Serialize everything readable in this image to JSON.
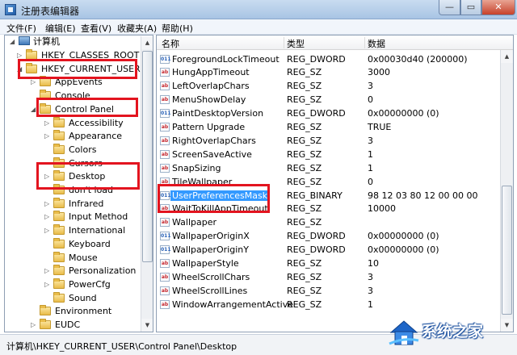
{
  "window": {
    "title": "注册表编辑器",
    "minimize_glyph": "—",
    "maximize_glyph": "▭",
    "close_glyph": "✕"
  },
  "menu": [
    "文件(F)",
    "编辑(E)",
    "查看(V)",
    "收藏夹(A)",
    "帮助(H)"
  ],
  "tree": {
    "root": "计算机",
    "items": [
      {
        "label": "HKEY_CLASSES_ROOT",
        "level": 1,
        "expander": "collapsed"
      },
      {
        "label": "HKEY_CURRENT_USER",
        "level": 1,
        "expander": "expanded"
      },
      {
        "label": "AppEvents",
        "level": 2,
        "expander": "collapsed"
      },
      {
        "label": "Console",
        "level": 2,
        "expander": "none"
      },
      {
        "label": "Control Panel",
        "level": 2,
        "expander": "expanded"
      },
      {
        "label": "Accessibility",
        "level": 3,
        "expander": "collapsed"
      },
      {
        "label": "Appearance",
        "level": 3,
        "expander": "collapsed"
      },
      {
        "label": "Colors",
        "level": 3,
        "expander": "none"
      },
      {
        "label": "Cursors",
        "level": 3,
        "expander": "none"
      },
      {
        "label": "Desktop",
        "level": 3,
        "expander": "collapsed"
      },
      {
        "label": "don't load",
        "level": 3,
        "expander": "none"
      },
      {
        "label": "Infrared",
        "level": 3,
        "expander": "collapsed"
      },
      {
        "label": "Input Method",
        "level": 3,
        "expander": "collapsed"
      },
      {
        "label": "International",
        "level": 3,
        "expander": "collapsed"
      },
      {
        "label": "Keyboard",
        "level": 3,
        "expander": "none"
      },
      {
        "label": "Mouse",
        "level": 3,
        "expander": "none"
      },
      {
        "label": "Personalization",
        "level": 3,
        "expander": "collapsed"
      },
      {
        "label": "PowerCfg",
        "level": 3,
        "expander": "collapsed"
      },
      {
        "label": "Sound",
        "level": 3,
        "expander": "none"
      },
      {
        "label": "Environment",
        "level": 2,
        "expander": "none"
      },
      {
        "label": "EUDC",
        "level": 2,
        "expander": "collapsed"
      }
    ]
  },
  "list": {
    "headers": {
      "name": "名称",
      "type": "类型",
      "data": "数据"
    },
    "rows": [
      {
        "name": "ForegroundLockTimeout",
        "type": "REG_DWORD",
        "data": "0x00030d40 (200000)",
        "icon": "bin"
      },
      {
        "name": "HungAppTimeout",
        "type": "REG_SZ",
        "data": "3000",
        "icon": "sz"
      },
      {
        "name": "LeftOverlapChars",
        "type": "REG_SZ",
        "data": "3",
        "icon": "sz"
      },
      {
        "name": "MenuShowDelay",
        "type": "REG_SZ",
        "data": "0",
        "icon": "sz"
      },
      {
        "name": "PaintDesktopVersion",
        "type": "REG_DWORD",
        "data": "0x00000000 (0)",
        "icon": "bin"
      },
      {
        "name": "Pattern Upgrade",
        "type": "REG_SZ",
        "data": "TRUE",
        "icon": "sz"
      },
      {
        "name": "RightOverlapChars",
        "type": "REG_SZ",
        "data": "3",
        "icon": "sz"
      },
      {
        "name": "ScreenSaveActive",
        "type": "REG_SZ",
        "data": "1",
        "icon": "sz"
      },
      {
        "name": "SnapSizing",
        "type": "REG_SZ",
        "data": "1",
        "icon": "sz"
      },
      {
        "name": "TileWallpaper",
        "type": "REG_SZ",
        "data": "0",
        "icon": "sz"
      },
      {
        "name": "UserPreferencesMask",
        "type": "REG_BINARY",
        "data": "98 12 03 80 12 00 00 00",
        "icon": "bin",
        "selected": true
      },
      {
        "name": "WaitToKillAppTimeout",
        "type": "REG_SZ",
        "data": "10000",
        "icon": "sz"
      },
      {
        "name": "Wallpaper",
        "type": "REG_SZ",
        "data": "",
        "icon": "sz"
      },
      {
        "name": "WallpaperOriginX",
        "type": "REG_DWORD",
        "data": "0x00000000 (0)",
        "icon": "bin"
      },
      {
        "name": "WallpaperOriginY",
        "type": "REG_DWORD",
        "data": "0x00000000 (0)",
        "icon": "bin"
      },
      {
        "name": "WallpaperStyle",
        "type": "REG_SZ",
        "data": "10",
        "icon": "sz"
      },
      {
        "name": "WheelScrollChars",
        "type": "REG_SZ",
        "data": "3",
        "icon": "sz"
      },
      {
        "name": "WheelScrollLines",
        "type": "REG_SZ",
        "data": "3",
        "icon": "sz"
      },
      {
        "name": "WindowArrangementActive",
        "type": "REG_SZ",
        "data": "1",
        "icon": "sz"
      }
    ]
  },
  "value_icons": {
    "sz": "ab",
    "bin": "011"
  },
  "status": {
    "path": "计算机\\HKEY_CURRENT_USER\\Control Panel\\Desktop"
  },
  "colors": {
    "selection": "#3399ff",
    "highlight_box": "#e3141f",
    "titlebar": "#b9d1ea"
  },
  "watermark": {
    "text": "系统之家"
  }
}
